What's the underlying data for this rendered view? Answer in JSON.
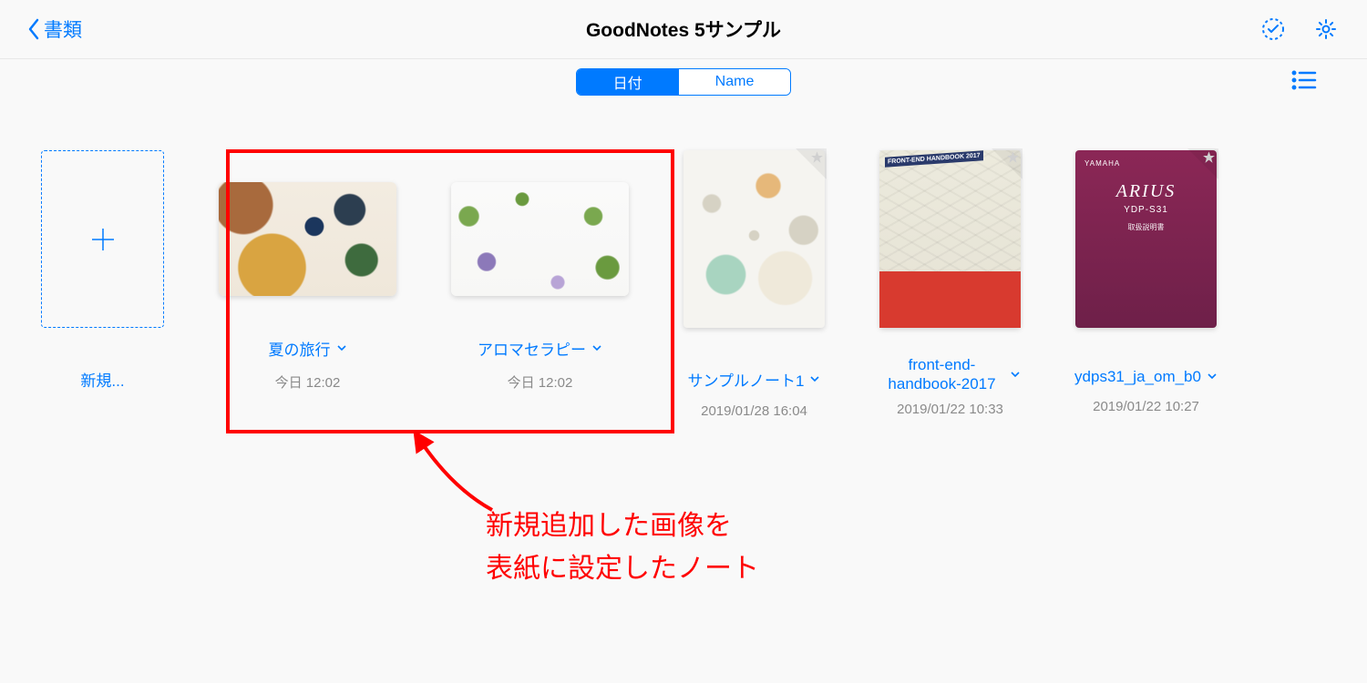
{
  "header": {
    "back_label": "書類",
    "title": "GoodNotes 5サンプル"
  },
  "toolbar": {
    "seg": {
      "date": "日付",
      "name": "Name"
    }
  },
  "new_label": "新規...",
  "notes": [
    {
      "title": "夏の旅行",
      "date": "今日 12:02"
    },
    {
      "title": "アロマセラピー",
      "date": "今日 12:02"
    },
    {
      "title": "サンプルノート1",
      "date": "2019/01/28 16:04"
    },
    {
      "title": "front-end-handbook-2017",
      "date": "2019/01/22 10:33"
    },
    {
      "title": "ydps31_ja_om_b0",
      "date": "2019/01/22 10:27"
    }
  ],
  "cover5": {
    "brand": "YAMAHA",
    "name": "ARIUS",
    "model": "YDP-S31",
    "sub": "取扱説明書"
  },
  "cover4": {
    "ribbon": "FRONT-END HANDBOOK 2017"
  },
  "annotation": "新規追加した画像を\n表紙に設定したノート"
}
